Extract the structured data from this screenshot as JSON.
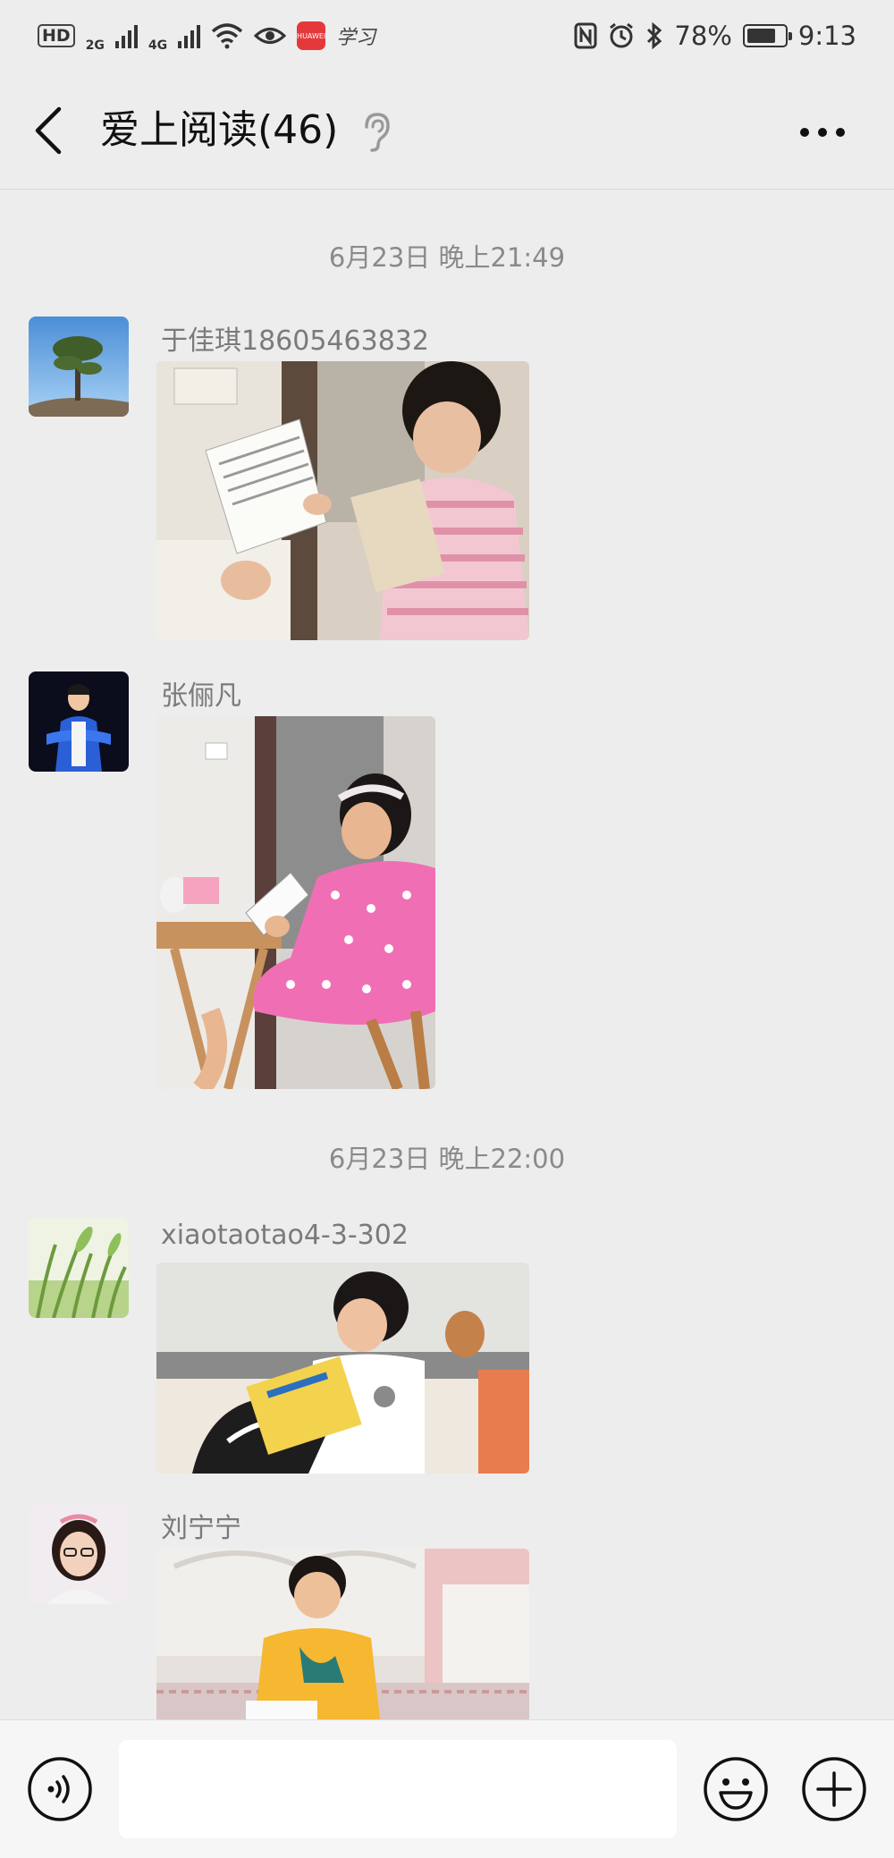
{
  "status_bar": {
    "hd_label": "HD",
    "hd_sub": "2",
    "net1": "2G",
    "net2": "4G",
    "app_badge": "HUAWEI",
    "app_text": "学习",
    "battery_text": "78%",
    "battery_level": 0.78,
    "time": "9:13"
  },
  "nav": {
    "title": "爱上阅读(46)"
  },
  "chat": {
    "timestamps": [
      "6月23日 晚上21:49",
      "6月23日 晚上22:00"
    ],
    "messages": [
      {
        "sender": "于佳琪18605463832",
        "photo": "girl-reading-striped-shirt"
      },
      {
        "sender": "张俪凡",
        "photo": "girl-reading-pink-dress"
      },
      {
        "sender": "xiaotaotao4-3-302",
        "photo": "girl-reading-on-sofa"
      },
      {
        "sender": "刘宁宁",
        "photo": "boy-reading-yellow-shirt"
      }
    ]
  },
  "input": {
    "placeholder": ""
  },
  "colors": {
    "background": "#ededed",
    "input_bar": "#f6f6f6",
    "timestamp_text": "#8a8a8a",
    "sender_text": "#7a7a7a"
  }
}
